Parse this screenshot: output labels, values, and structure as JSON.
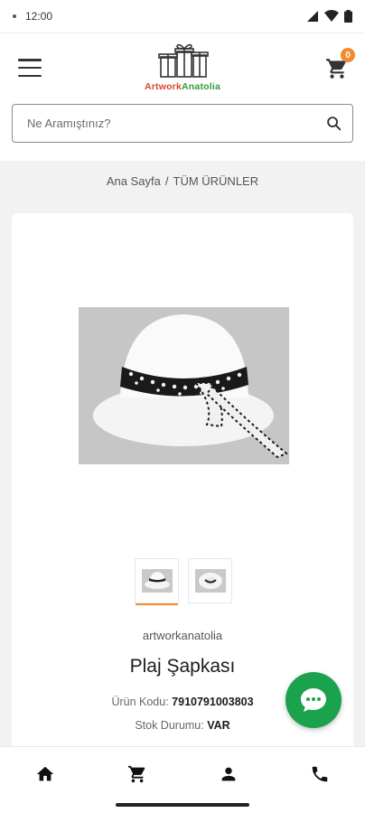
{
  "status_bar": {
    "time": "12:00"
  },
  "header": {
    "logo": {
      "part1": "Artwork",
      "part2": "Anatolia"
    },
    "cart_count": "0"
  },
  "search": {
    "placeholder": "Ne Aramıştınız?",
    "value": ""
  },
  "breadcrumb": {
    "home": "Ana Sayfa",
    "separator": "/",
    "current": "TÜM ÜRÜNLER"
  },
  "product": {
    "brand": "artworkanatolia",
    "title": "Plaj Şapkası",
    "code_label": "Ürün Kodu:",
    "code_value": "7910791003803",
    "stock_label": "Stok Durumu:",
    "stock_value": "VAR",
    "thumbnails": [
      "hat-thumbnail-1",
      "hat-thumbnail-2"
    ],
    "active_thumbnail": 0
  },
  "bottom_nav": {
    "items": [
      {
        "icon": "home-icon"
      },
      {
        "icon": "cart-icon"
      },
      {
        "icon": "user-icon"
      },
      {
        "icon": "phone-icon"
      }
    ]
  },
  "colors": {
    "accent": "#f28a2e",
    "chat": "#1aa24c",
    "logo_red": "#d9472b",
    "logo_green": "#2e9e3c"
  }
}
